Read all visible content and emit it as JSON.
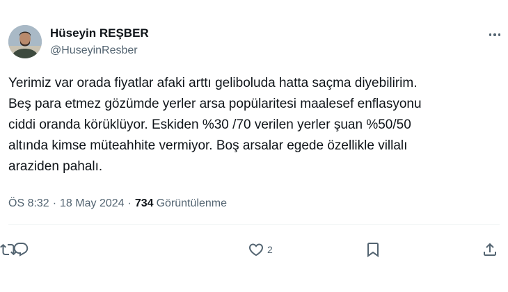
{
  "author": {
    "name": "Hüseyin REŞBER",
    "handle": "@HuseyinResber"
  },
  "tweet": {
    "lines": [
      "Yerimiz var orada fiyatlar afaki arttı geliboluda hatta saçma diyebilirim.",
      "Beş para etmez gözümde yerler arsa popülaritesi maalesef enflasyonu",
      "ciddi oranda körüklüyor. Eskiden %30 /70 verilen yerler şuan %50/50",
      "altında kimse müteahhite vermiyor. Boş arsalar egede özellikle villalı",
      "araziden pahalı."
    ]
  },
  "meta": {
    "time": "ÖS 8:32",
    "separator": "·",
    "date": "18 May 2024",
    "views_count": "734",
    "views_label": "Görüntülenme"
  },
  "actions": {
    "reply_icon": "reply-icon",
    "retweet_icon": "retweet-icon",
    "like_icon": "heart-icon",
    "like_count": "2",
    "bookmark_icon": "bookmark-icon",
    "share_icon": "share-icon"
  },
  "colors": {
    "text": "#0f1419",
    "secondary": "#536471",
    "divider": "#eff3f4"
  }
}
